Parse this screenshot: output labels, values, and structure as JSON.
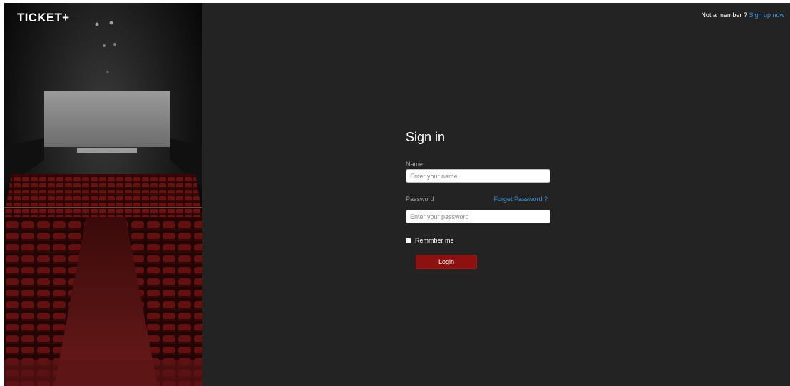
{
  "brand": {
    "logo_text": "TICKET+"
  },
  "header": {
    "not_member_text": "Not a member ?",
    "signup_link": "Sign up now"
  },
  "signin": {
    "title": "Sign in",
    "name_label": "Name",
    "name_placeholder": "Enter your name",
    "name_value": "",
    "password_label": "Password",
    "forget_password_link": "Forget Password ?",
    "password_placeholder": "Enter your password",
    "password_value": "",
    "remember_label": "Remmber me",
    "remember_checked": false,
    "login_button": "Login"
  },
  "colors": {
    "background": "#232323",
    "link": "#3b8fd6",
    "login_button": "#8e1111",
    "seat_red": "#5a0f0f"
  },
  "icons": {
    "remember_checkbox": "checkbox-icon"
  }
}
